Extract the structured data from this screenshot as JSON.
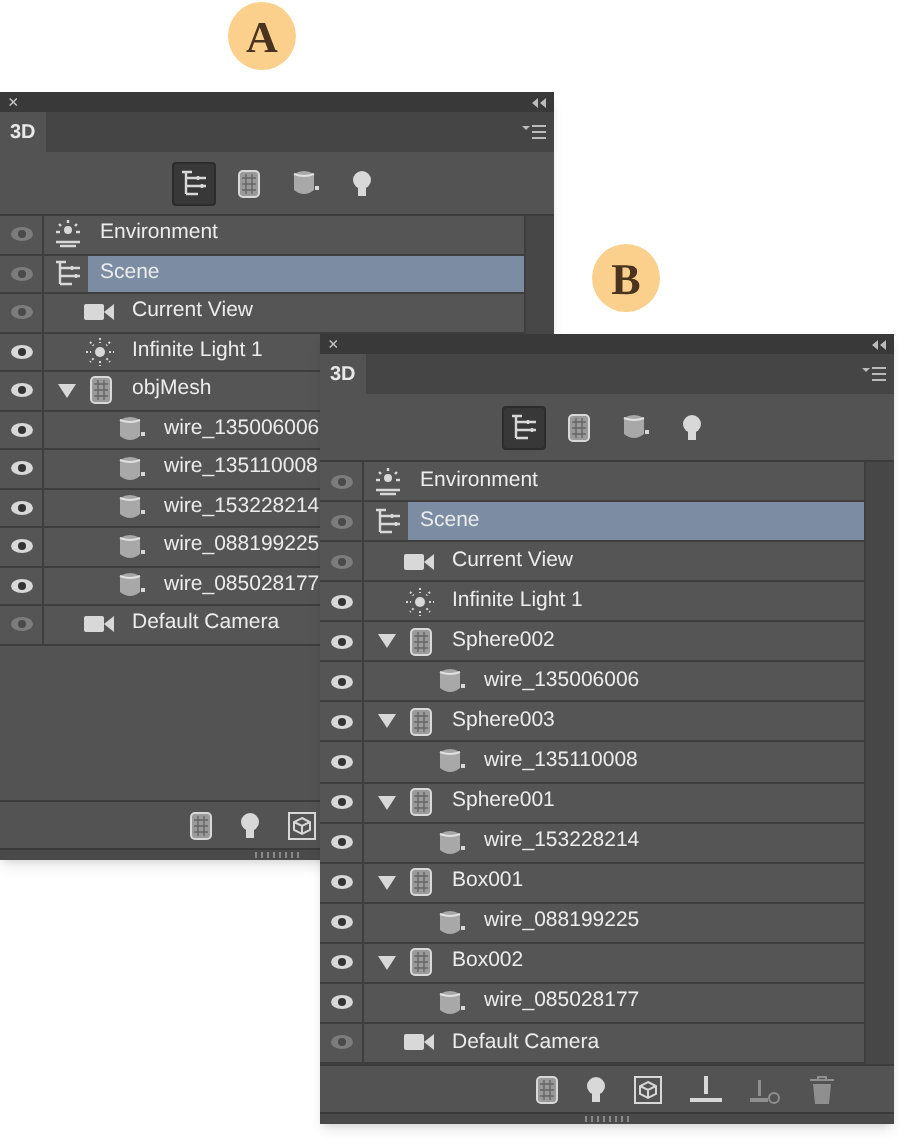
{
  "panels": [
    {
      "badge": "A",
      "close": "×",
      "tab": "3D",
      "filters": [
        {
          "kind": "scene",
          "selected": true
        },
        {
          "kind": "mesh",
          "selected": false
        },
        {
          "kind": "material",
          "selected": false
        },
        {
          "kind": "light",
          "selected": false
        }
      ],
      "layers": [
        {
          "name": "Environment",
          "kind": "environment",
          "visible": false,
          "selected": false
        },
        {
          "name": "Scene",
          "kind": "scene",
          "visible": false,
          "selected": true,
          "children": [
            {
              "name": "Current View",
              "kind": "camera",
              "visible": false,
              "selected": false
            },
            {
              "name": "Infinite Light 1",
              "kind": "light",
              "visible": true,
              "selected": false
            },
            {
              "name": "objMesh",
              "kind": "mesh",
              "visible": true,
              "selected": false,
              "expanded": true,
              "children": [
                {
                  "name": "wire_135006006",
                  "kind": "material",
                  "visible": true,
                  "selected": false
                },
                {
                  "name": "wire_135110008",
                  "kind": "material",
                  "visible": true,
                  "selected": false
                },
                {
                  "name": "wire_153228214",
                  "kind": "material",
                  "visible": true,
                  "selected": false
                },
                {
                  "name": "wire_088199225",
                  "kind": "material",
                  "visible": true,
                  "selected": false
                },
                {
                  "name": "wire_085028177",
                  "kind": "material",
                  "visible": true,
                  "selected": false
                }
              ]
            },
            {
              "name": "Default Camera",
              "kind": "camera",
              "visible": false,
              "selected": false
            }
          ]
        }
      ],
      "tools": [
        {
          "kind": "mesh",
          "disabled": false
        },
        {
          "kind": "light",
          "disabled": false
        },
        {
          "kind": "cube",
          "disabled": false
        }
      ]
    },
    {
      "badge": "B",
      "close": "×",
      "tab": "3D",
      "filters": [
        {
          "kind": "scene",
          "selected": true
        },
        {
          "kind": "mesh",
          "selected": false
        },
        {
          "kind": "material",
          "selected": false
        },
        {
          "kind": "light",
          "selected": false
        }
      ],
      "layers": [
        {
          "name": "Environment",
          "kind": "environment",
          "visible": false,
          "selected": false
        },
        {
          "name": "Scene",
          "kind": "scene",
          "visible": false,
          "selected": true,
          "children": [
            {
              "name": "Current View",
              "kind": "camera",
              "visible": false,
              "selected": false
            },
            {
              "name": "Infinite Light 1",
              "kind": "light",
              "visible": true,
              "selected": false
            },
            {
              "name": "Sphere002",
              "kind": "mesh",
              "visible": true,
              "selected": false,
              "expanded": true,
              "children": [
                {
                  "name": "wire_135006006",
                  "kind": "material",
                  "visible": true,
                  "selected": false
                }
              ]
            },
            {
              "name": "Sphere003",
              "kind": "mesh",
              "visible": true,
              "selected": false,
              "expanded": true,
              "children": [
                {
                  "name": "wire_135110008",
                  "kind": "material",
                  "visible": true,
                  "selected": false
                }
              ]
            },
            {
              "name": "Sphere001",
              "kind": "mesh",
              "visible": true,
              "selected": false,
              "expanded": true,
              "children": [
                {
                  "name": "wire_153228214",
                  "kind": "material",
                  "visible": true,
                  "selected": false
                }
              ]
            },
            {
              "name": "Box001",
              "kind": "mesh",
              "visible": true,
              "selected": false,
              "expanded": true,
              "children": [
                {
                  "name": "wire_088199225",
                  "kind": "material",
                  "visible": true,
                  "selected": false
                }
              ]
            },
            {
              "name": "Box002",
              "kind": "mesh",
              "visible": true,
              "selected": false,
              "expanded": true,
              "children": [
                {
                  "name": "wire_085028177",
                  "kind": "material",
                  "visible": true,
                  "selected": false
                }
              ]
            },
            {
              "name": "Default Camera",
              "kind": "camera",
              "visible": false,
              "selected": false
            }
          ]
        }
      ],
      "tools": [
        {
          "kind": "mesh",
          "disabled": false
        },
        {
          "kind": "light",
          "disabled": false
        },
        {
          "kind": "cube",
          "disabled": false
        },
        {
          "kind": "ground",
          "disabled": false
        },
        {
          "kind": "ground-off",
          "disabled": true
        },
        {
          "kind": "trash",
          "disabled": true
        }
      ]
    }
  ]
}
